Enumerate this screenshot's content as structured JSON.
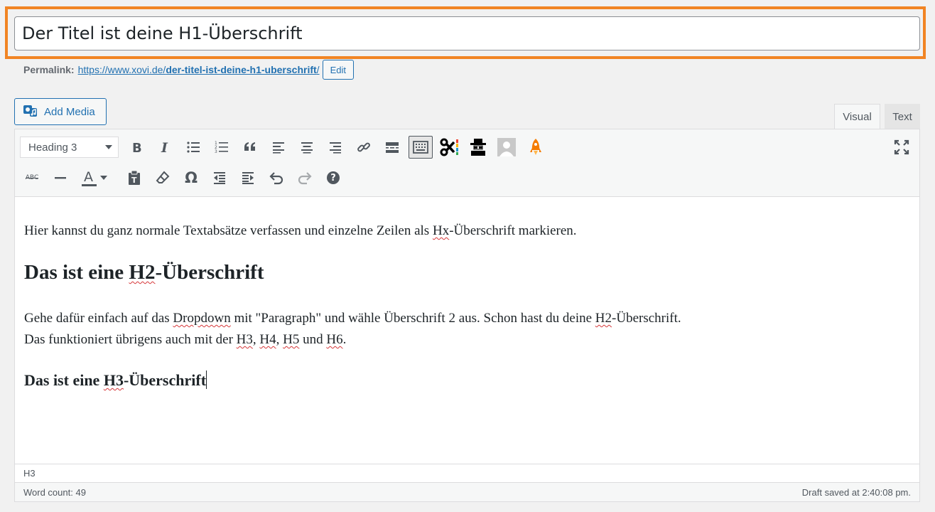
{
  "title": {
    "value": "Der Titel ist deine H1-Überschrift"
  },
  "permalink": {
    "label": "Permalink:",
    "url_prefix": "https://www.xovi.de/",
    "url_slug": "der-titel-ist-deine-h1-uberschrift",
    "url_suffix": "/",
    "edit_label": "Edit"
  },
  "media": {
    "add_media_label": "Add Media"
  },
  "tabs": {
    "visual": "Visual",
    "text": "Text"
  },
  "toolbar": {
    "format_select_value": "Heading 3",
    "row1_icons": [
      "bold-icon",
      "italic-icon",
      "bullet-list-icon",
      "numbered-list-icon",
      "blockquote-icon",
      "align-left-icon",
      "align-center-icon",
      "align-right-icon",
      "link-icon",
      "read-more-icon",
      "toolbar-toggle-icon",
      "scissors-plugin-icon",
      "spy-plugin-icon",
      "avatar-plugin-icon",
      "rocket-plugin-icon",
      "fullscreen-icon"
    ],
    "row2_icons": [
      "strikethrough-icon",
      "horizontal-line-icon",
      "text-color-icon",
      "paste-text-icon",
      "clear-formatting-icon",
      "special-character-icon",
      "outdent-icon",
      "indent-icon",
      "undo-icon",
      "redo-icon",
      "help-icon"
    ],
    "strikethrough_text": "ABC",
    "text_color_letter": "A",
    "omega": "Ω",
    "help": "?"
  },
  "content": {
    "p1_before": "Hier kannst du ganz normale Textabsätze verfassen und einzelne Zeilen als ",
    "p1_spell": "Hx",
    "p1_after": "-Überschrift markieren.",
    "h2_before": "Das ist eine ",
    "h2_spell": "H2",
    "h2_after": "-Überschrift",
    "p2_a": "Gehe dafür einfach auf das ",
    "p2_spell1": "Dropdown",
    "p2_b": " mit \"Paragraph\" und wähle Überschrift 2 aus. Schon hast du deine ",
    "p2_spell2": "H2",
    "p2_c": "-Überschrift.",
    "p3_a": "Das funktioniert übrigens auch mit der ",
    "p3_h3": "H3",
    "p3_sep1": ", ",
    "p3_h4": "H4",
    "p3_sep2": ", ",
    "p3_h5": "H5",
    "p3_und": " und ",
    "p3_h6": "H6",
    "p3_end": ".",
    "h3_before": "Das ist eine ",
    "h3_spell": "H3",
    "h3_after": "-Überschrift"
  },
  "status": {
    "path": "H3",
    "word_count": "Word count: 49",
    "draft_saved": "Draft saved at 2:40:08 pm."
  },
  "colors": {
    "highlight_border": "#f18423",
    "link": "#2271b1",
    "spellcheck": "#d63638"
  }
}
